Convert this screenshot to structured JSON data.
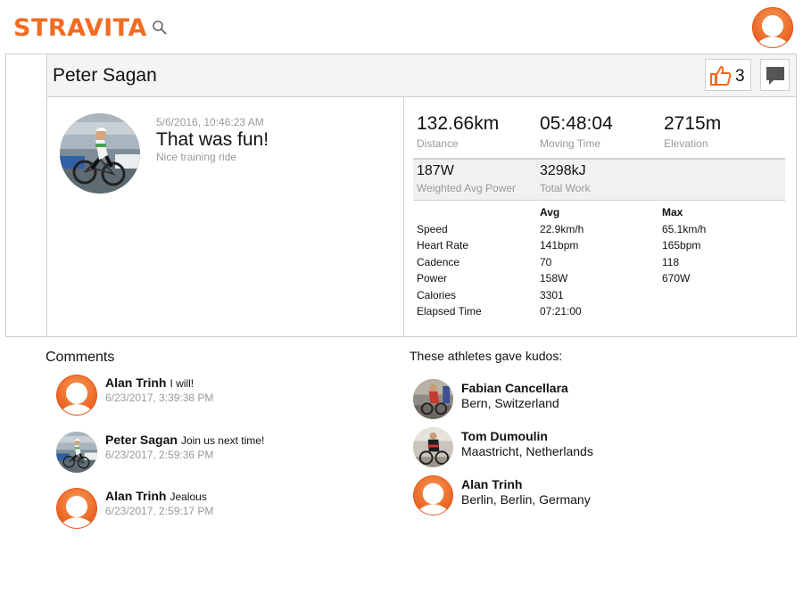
{
  "app": {
    "logo": "STRAVITA"
  },
  "colors": {
    "brand": "#f26b21",
    "muted": "#999999",
    "border": "#cfcfcf",
    "panel": "#f4f4f4"
  },
  "icons": {
    "search": "search-icon",
    "avatar": "default-avatar-icon",
    "kudos": "thumbs-up-icon",
    "comment": "comment-icon"
  },
  "activity": {
    "athlete": "Peter Sagan",
    "kudos_count": "3",
    "date": "5/6/2016, 10:46:23 AM",
    "title": "That was fun!",
    "description": "Nice training ride"
  },
  "stats": {
    "distance": {
      "value": "132.66km",
      "label": "Distance"
    },
    "moving_time": {
      "value": "05:48:04",
      "label": "Moving Time"
    },
    "elevation": {
      "value": "2715m",
      "label": "Elevation"
    },
    "weighted_power": {
      "value": "187W",
      "label": "Weighted Avg Power"
    },
    "total_work": {
      "value": "3298kJ",
      "label": "Total Work"
    }
  },
  "table": {
    "headers": [
      "",
      "Avg",
      "Max"
    ],
    "rows": [
      {
        "label": "Speed",
        "avg": "22.9km/h",
        "max": "65.1km/h"
      },
      {
        "label": "Heart Rate",
        "avg": "141bpm",
        "max": "165bpm"
      },
      {
        "label": "Cadence",
        "avg": "70",
        "max": "118"
      },
      {
        "label": "Power",
        "avg": "158W",
        "max": "670W"
      },
      {
        "label": "Calories",
        "avg": "3301",
        "max": ""
      },
      {
        "label": "Elapsed Time",
        "avg": "07:21:00",
        "max": ""
      }
    ]
  },
  "comments": {
    "title": "Comments",
    "items": [
      {
        "name": "Alan Trinh",
        "text": "I will!",
        "date": "6/23/2017, 3:39:38 PM"
      },
      {
        "name": "Peter Sagan",
        "text": "Join us next time!",
        "date": "6/23/2017, 2:59:36 PM"
      },
      {
        "name": "Alan Trinh",
        "text": "Jealous",
        "date": "6/23/2017, 2:59:17 PM"
      }
    ]
  },
  "kudos": {
    "title": "These athletes gave kudos:",
    "items": [
      {
        "name": "Fabian Cancellara",
        "location": "Bern, Switzerland"
      },
      {
        "name": "Tom Dumoulin",
        "location": "Maastricht, Netherlands"
      },
      {
        "name": "Alan Trinh",
        "location": "Berlin, Berlin, Germany"
      }
    ]
  }
}
